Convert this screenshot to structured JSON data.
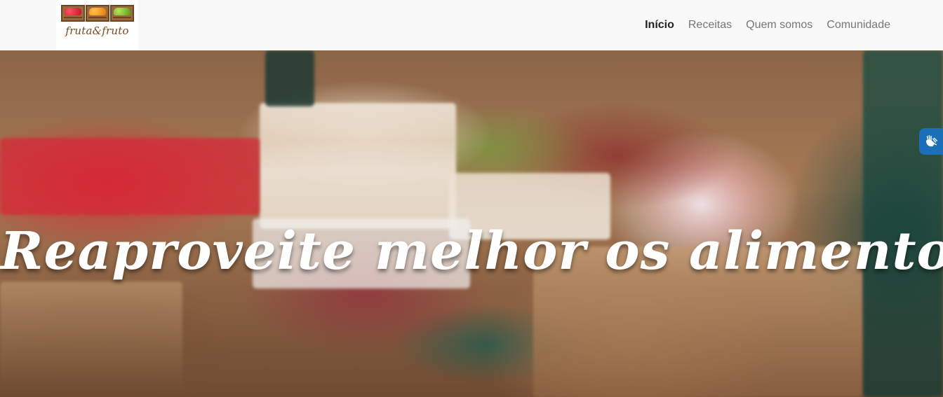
{
  "logo": {
    "text": "fruta&fruto",
    "icon": "fruit-crates-logo"
  },
  "nav": {
    "items": [
      {
        "label": "Início",
        "active": true
      },
      {
        "label": "Receitas",
        "active": false
      },
      {
        "label": "Quem somos",
        "active": false
      },
      {
        "label": "Comunidade",
        "active": false
      }
    ]
  },
  "hero": {
    "title": "Reaproveite melhor os alimentos!",
    "background": "market-fruit-stall-photo"
  },
  "accessibility": {
    "icon": "sign-language-hands-icon",
    "color": "#1a6fb8"
  }
}
